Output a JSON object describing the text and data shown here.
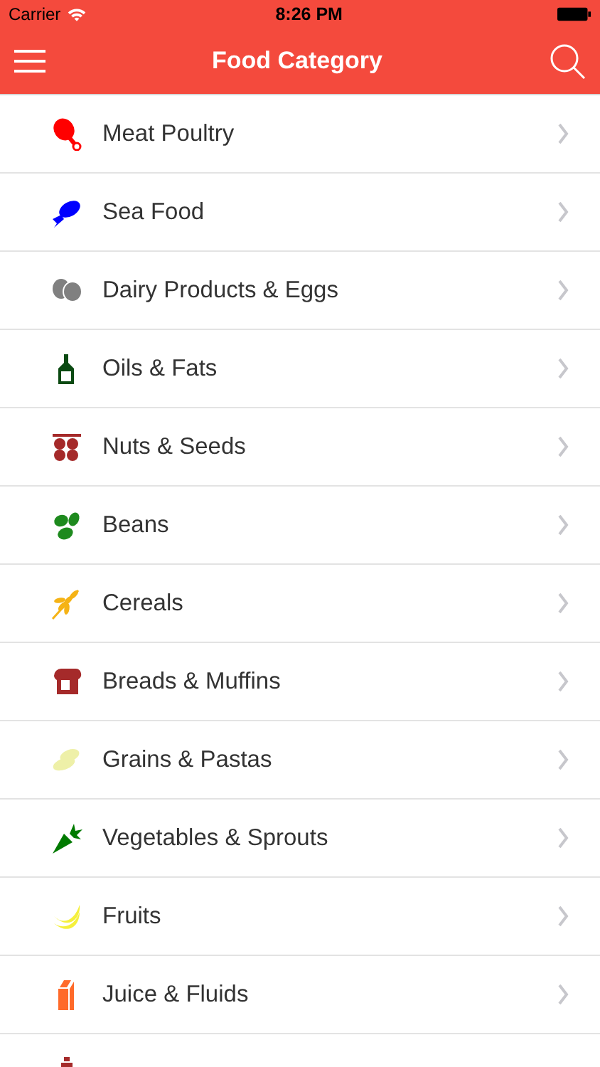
{
  "status_bar": {
    "carrier": "Carrier",
    "time": "8:26 PM"
  },
  "nav_bar": {
    "title": "Food Category"
  },
  "categories": [
    {
      "label": "Meat Poultry",
      "kind": "drumstick",
      "color": "#ff0000"
    },
    {
      "label": "Sea Food",
      "kind": "fish",
      "color": "#0000ff"
    },
    {
      "label": "Dairy Products & Eggs",
      "kind": "eggs",
      "color": "#808080"
    },
    {
      "label": "Oils & Fats",
      "kind": "bottle",
      "color": "#0b4a12"
    },
    {
      "label": "Nuts & Seeds",
      "kind": "nuts",
      "color": "#a52a2a"
    },
    {
      "label": "Beans",
      "kind": "beans",
      "color": "#1e8a1e"
    },
    {
      "label": "Cereals",
      "kind": "wheat",
      "color": "#f5b316"
    },
    {
      "label": "Breads & Muffins",
      "kind": "bread",
      "color": "#a52a2a"
    },
    {
      "label": "Grains & Pastas",
      "kind": "grains",
      "color": "#eef0a8"
    },
    {
      "label": "Vegetables & Sprouts",
      "kind": "carrot",
      "color": "#007a00"
    },
    {
      "label": "Fruits",
      "kind": "banana",
      "color": "#f5f03c"
    },
    {
      "label": "Juice & Fluids",
      "kind": "carton",
      "color": "#ff6a2a"
    },
    {
      "kind": "shaker",
      "color": "#a52a2a"
    }
  ]
}
